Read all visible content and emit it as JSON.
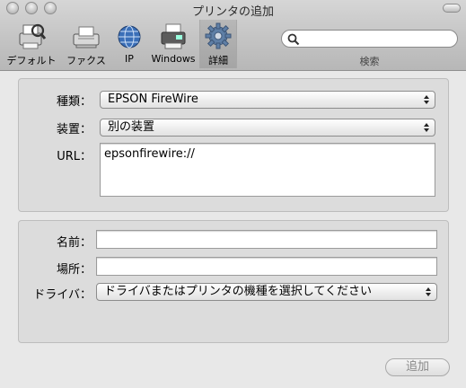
{
  "window": {
    "title": "プリンタの追加"
  },
  "toolbar": {
    "items": [
      {
        "label": "デフォルト",
        "icon": "default-browser-icon"
      },
      {
        "label": "ファクス",
        "icon": "fax-icon"
      },
      {
        "label": "IP",
        "icon": "ip-globe-icon"
      },
      {
        "label": "Windows",
        "icon": "windows-printer-icon"
      },
      {
        "label": "詳細",
        "icon": "gear-icon",
        "selected": true
      }
    ],
    "search": {
      "label": "検索",
      "value": ""
    }
  },
  "form": {
    "type_label": "種類：",
    "type_value": "EPSON FireWire",
    "device_label": "装置：",
    "device_value": "別の装置",
    "url_label": "URL：",
    "url_value": "epsonfirewire://",
    "name_label": "名前：",
    "name_value": "",
    "location_label": "場所：",
    "location_value": "",
    "driver_label": "ドライバ：",
    "driver_value": "ドライバまたはプリンタの機種を選択してください"
  },
  "buttons": {
    "add": "追加"
  },
  "colors": {
    "gear_blue": "#5f7fa6",
    "disabled_text": "#8a8a8a"
  }
}
